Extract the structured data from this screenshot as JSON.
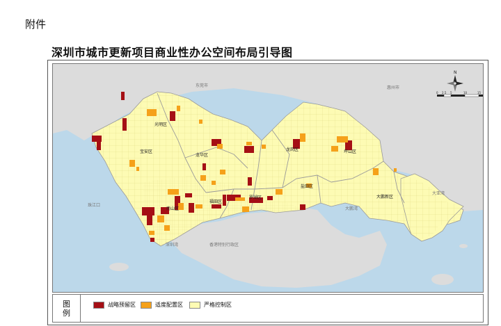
{
  "header": {
    "attachment": "附件",
    "title": "深圳市城市更新项目商业性办公空间布局引导图"
  },
  "colors": {
    "strategic": "#a50f15",
    "moderate": "#f5a11a",
    "strict": "#fdfbb4",
    "sea": "#bcd8ea",
    "land_outside": "#dcdcdc"
  },
  "map": {
    "compass": "N",
    "outer_labels": {
      "dongguan": "东莞市",
      "huizhou": "惠州市",
      "hk": "香港特别行政区",
      "zhujiangkou": "珠江口",
      "shenzhenwan": "深圳湾",
      "dapengwan": "大鹏湾",
      "dayawan": "大亚湾"
    },
    "districts": {
      "guangming": "光明区",
      "baoan": "宝安区",
      "longhua": "龙华区",
      "longgang": "龙岗区",
      "pingshan": "坪山区",
      "nanshan": "南山区",
      "futian": "福田区",
      "luohu": "罗湖区",
      "yantian": "盐田区",
      "dapeng": "大鹏新区"
    },
    "scale": {
      "ticks": [
        "0",
        "2.5",
        "5",
        "10",
        "15",
        "20"
      ],
      "unit": "km"
    }
  },
  "legend": {
    "heading_line1": "图",
    "heading_line2": "例",
    "items": [
      {
        "label": "战略预留区",
        "color": "#a50f15"
      },
      {
        "label": "适度配置区",
        "color": "#f5a11a"
      },
      {
        "label": "严格控制区",
        "color": "#fdfbb4"
      }
    ]
  }
}
